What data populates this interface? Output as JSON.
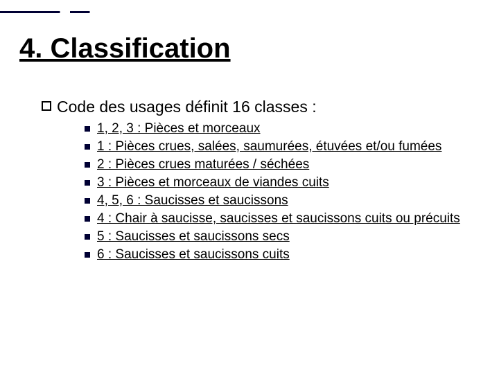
{
  "title": "4. Classification",
  "level1": {
    "text": "Code des usages définit 16 classes :"
  },
  "items": [
    "1, 2, 3 : Pièces et morceaux",
    "1 : Pièces crues, salées, saumurées, étuvées et/ou fumées",
    "2 : Pièces crues maturées / séchées",
    "3 : Pièces et morceaux de viandes cuits",
    "4, 5, 6 : Saucisses et saucissons",
    "4 : Chair à saucisse, saucisses et saucissons cuits ou précuits",
    "5 : Saucisses et saucissons secs",
    "6 : Saucisses et saucissons cuits"
  ]
}
